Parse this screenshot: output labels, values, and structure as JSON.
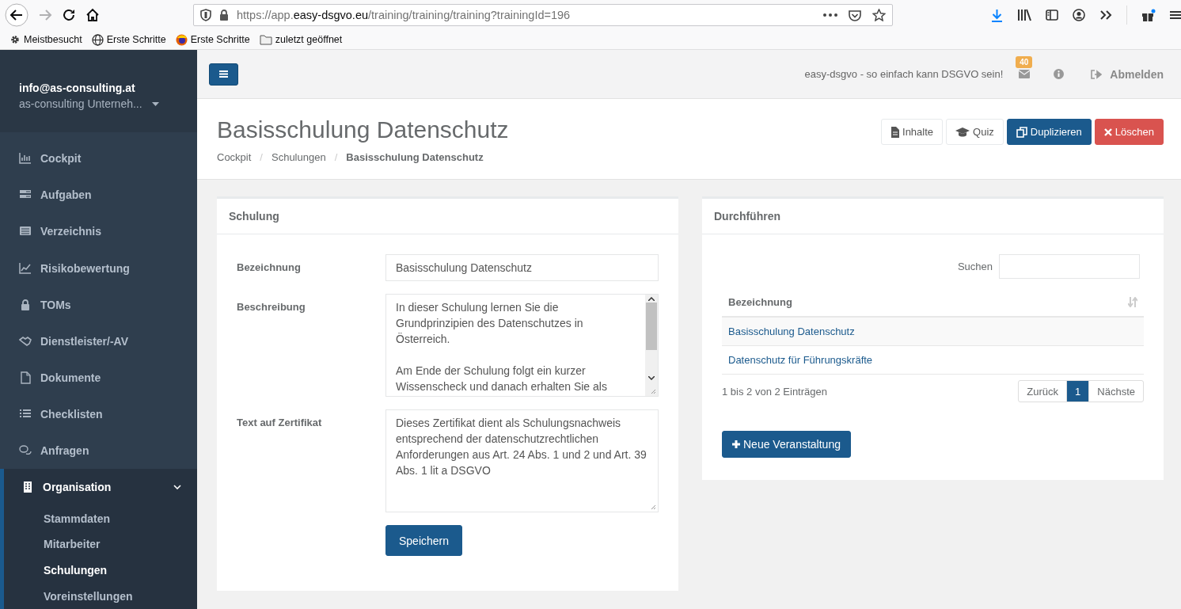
{
  "browser": {
    "url_start": "https://app.",
    "url_domain": "easy-dsgvo.eu",
    "url_path": "/training/training/training?trainingId=196",
    "bookmarks": [
      "Meistbesucht",
      "Erste Schritte",
      "Erste Schritte",
      "zuletzt geöffnet"
    ]
  },
  "sidebar": {
    "user_email": "info@as-consulting.at",
    "user_company": "as-consulting Unterneh...",
    "items": [
      {
        "label": "Cockpit",
        "selected": false
      },
      {
        "label": "Aufgaben",
        "selected": false
      },
      {
        "label": "Verzeichnis",
        "selected": false
      },
      {
        "label": "Risikobewertung",
        "selected": false
      },
      {
        "label": "TOMs",
        "selected": false
      },
      {
        "label": "Dienstleister/-AV",
        "selected": false
      },
      {
        "label": "Dokumente",
        "selected": false
      },
      {
        "label": "Checklisten",
        "selected": false
      },
      {
        "label": "Anfragen",
        "selected": false
      },
      {
        "label": "Organisation",
        "selected": true,
        "expanded": true,
        "children": [
          {
            "label": "Stammdaten",
            "selected": false
          },
          {
            "label": "Mitarbeiter",
            "selected": false
          },
          {
            "label": "Schulungen",
            "selected": true
          },
          {
            "label": "Voreinstellungen",
            "selected": false
          }
        ]
      }
    ]
  },
  "header": {
    "tagline": "easy-dsgvo - so einfach kann DSGVO sein!",
    "mail_count": "40",
    "logout": "Abmelden"
  },
  "page": {
    "title": "Basisschulung Datenschutz",
    "breadcrumbs": [
      "Cockpit",
      "Schulungen",
      "Basisschulung Datenschutz"
    ],
    "breadcrumb_separator": "/",
    "actions": [
      {
        "label": "Inhalte",
        "kind": "default"
      },
      {
        "label": "Quiz",
        "kind": "default"
      },
      {
        "label": "Duplizieren",
        "kind": "primary"
      },
      {
        "label": "Löschen",
        "kind": "danger"
      }
    ]
  },
  "form": {
    "title": "Schulung",
    "fields": [
      {
        "label": "Bezeichnung",
        "kind": "input",
        "value": "Basisschulung Datenschutz"
      },
      {
        "label": "Beschreibung",
        "kind": "textarea",
        "value": "In dieser Schulung lernen Sie die Grundprinzipien des Datenschutzes in Österreich.\n\nAm Ende der Schulung folgt ein kurzer Wissenscheck und danach erhalten Sie als",
        "scrollbar": true
      },
      {
        "label": "Text auf Zertifikat",
        "kind": "textarea",
        "value": "Dieses Zertifikat dient als Schulungsnachweis entsprechend der datenschutzrechtlichen Anforderungen aus Art. 24 Abs. 1 und 2 und Art. 39 Abs. 1 lit a DSGVO",
        "scrollbar": false
      }
    ],
    "save": "Speichern"
  },
  "events": {
    "title": "Durchführen",
    "search_label": "Suchen",
    "columns": [
      "Bezeichnung"
    ],
    "rows": [
      {
        "name": "Basisschulung Datenschutz"
      },
      {
        "name": "Datenschutz für Führungskräfte"
      }
    ],
    "info": "1 bis 2 von 2 Einträgen",
    "pagination": {
      "previous": "Zurück",
      "pages": [
        {
          "label": "1",
          "selected": true
        }
      ],
      "next": "Nächste"
    },
    "add_button": "Neue Veranstaltung"
  }
}
